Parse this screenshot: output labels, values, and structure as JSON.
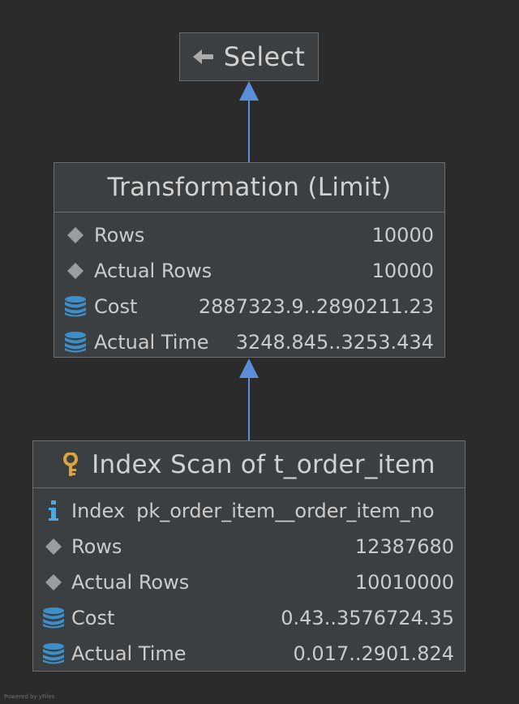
{
  "nodes": {
    "select": {
      "icon": "back-arrow-icon",
      "title": "Select"
    },
    "transformation": {
      "title": "Transformation (Limit)",
      "rows": [
        {
          "icon": "diamond-icon",
          "label": "Rows",
          "value": "10000"
        },
        {
          "icon": "diamond-icon",
          "label": "Actual Rows",
          "value": "10000"
        },
        {
          "icon": "database-icon",
          "label": "Cost",
          "value": "2887323.9..2890211.23"
        },
        {
          "icon": "database-icon",
          "label": "Actual Time",
          "value": "3248.845..3253.434"
        }
      ]
    },
    "index_scan": {
      "icon": "key-icon",
      "title": "Index Scan of t_order_item",
      "rows": [
        {
          "icon": "info-icon",
          "label": "Index",
          "value": "pk_order_item__order_item_no"
        },
        {
          "icon": "diamond-icon",
          "label": "Rows",
          "value": "12387680"
        },
        {
          "icon": "diamond-icon",
          "label": "Actual Rows",
          "value": "10010000"
        },
        {
          "icon": "database-icon",
          "label": "Cost",
          "value": "0.43..3576724.35"
        },
        {
          "icon": "database-icon",
          "label": "Actual Time",
          "value": "0.017..2901.824"
        }
      ]
    }
  },
  "colors": {
    "background": "#2b2b2b",
    "node_fill": "#3c3f41",
    "node_border": "#6b6e70",
    "edge": "#5a8ed6",
    "database_icon": "#3d8fc9",
    "info_icon": "#4fa8e0",
    "key_icon": "#d9a441",
    "diamond_icon": "#9a9c9e"
  },
  "footer": "Powered by yFiles"
}
